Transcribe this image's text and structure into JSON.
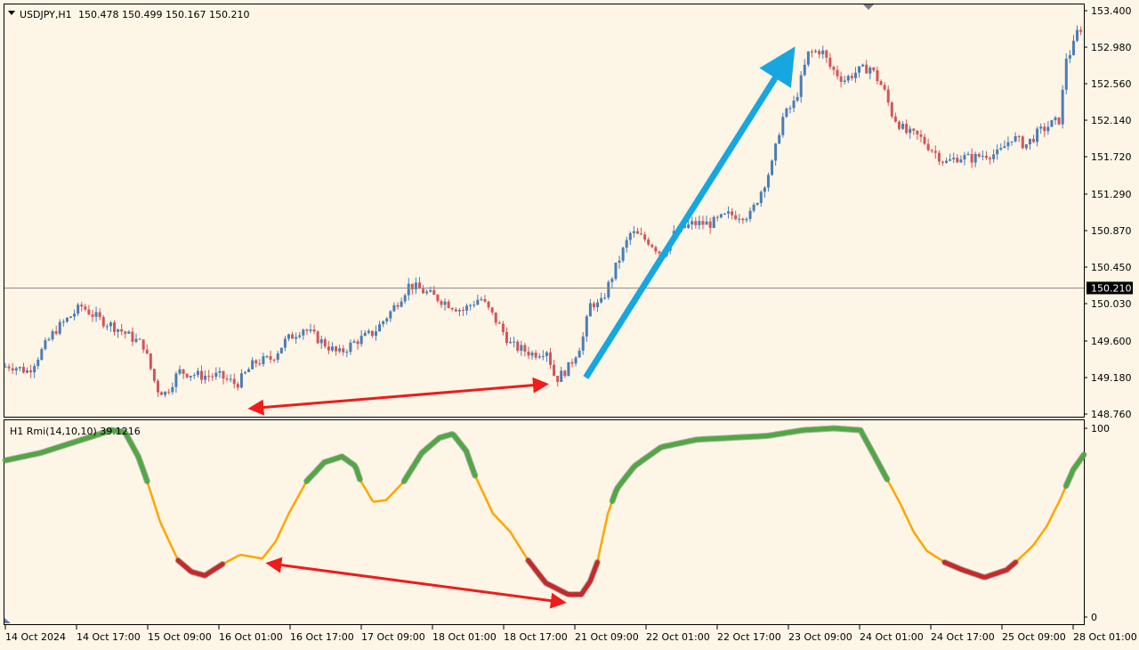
{
  "main": {
    "symbol_label": "USDJPY,H1",
    "ohlc_label": "150.478 150.499 150.167 150.210"
  },
  "indicator": {
    "label": "H1 Rmi(14,10,10) 39.1216"
  },
  "colors": {
    "background": "#FDF5E6",
    "bull_candle": "#4A7DB5",
    "bear_candle": "#D2555B",
    "price_line": "#8C8C8C",
    "current_price_box": "#000000",
    "rmi_neutral": "#FFA500",
    "rmi_bull": "#4FA843",
    "rmi_bear": "#C8282A",
    "trend_arrow": "#17A7E0",
    "divergence_arrow": "#EE1C1C",
    "grid_border": "#000000"
  },
  "chart_data": [
    {
      "type": "candlestick",
      "title": "USDJPY,H1",
      "ylim": [
        148.76,
        153.4
      ],
      "y_ticks": [
        "153.400",
        "152.980",
        "152.560",
        "152.140",
        "151.720",
        "151.290",
        "150.870",
        "150.450",
        "150.030",
        "149.600",
        "149.180",
        "148.760"
      ],
      "current_price": "150.210",
      "x_ticks": [
        "14 Oct 2024",
        "14 Oct 17:00",
        "15 Oct 09:00",
        "16 Oct 01:00",
        "16 Oct 17:00",
        "17 Oct 09:00",
        "18 Oct 01:00",
        "18 Oct 17:00",
        "21 Oct 09:00",
        "22 Oct 01:00",
        "22 Oct 17:00",
        "23 Oct 09:00",
        "24 Oct 01:00",
        "24 Oct 17:00",
        "25 Oct 09:00",
        "28 Oct 01:00"
      ],
      "close_path": [
        [
          0,
          149.3
        ],
        [
          10,
          149.32
        ],
        [
          30,
          149.25
        ],
        [
          60,
          149.72
        ],
        [
          90,
          150.0
        ],
        [
          110,
          149.85
        ],
        [
          130,
          149.75
        ],
        [
          160,
          149.55
        ],
        [
          175,
          149.05
        ],
        [
          185,
          149.0
        ],
        [
          200,
          149.25
        ],
        [
          225,
          149.2
        ],
        [
          245,
          149.2
        ],
        [
          265,
          149.1
        ],
        [
          285,
          149.35
        ],
        [
          305,
          149.4
        ],
        [
          320,
          149.6
        ],
        [
          340,
          149.75
        ],
        [
          360,
          149.6
        ],
        [
          380,
          149.45
        ],
        [
          400,
          149.6
        ],
        [
          420,
          149.7
        ],
        [
          440,
          149.95
        ],
        [
          460,
          150.25
        ],
        [
          480,
          150.15
        ],
        [
          500,
          150.05
        ],
        [
          520,
          149.95
        ],
        [
          540,
          150.1
        ],
        [
          560,
          149.8
        ],
        [
          575,
          149.55
        ],
        [
          600,
          149.45
        ],
        [
          615,
          149.5
        ],
        [
          625,
          149.15
        ],
        [
          640,
          149.3
        ],
        [
          655,
          149.6
        ],
        [
          665,
          150.05
        ],
        [
          675,
          150.0
        ],
        [
          695,
          150.5
        ],
        [
          710,
          150.85
        ],
        [
          730,
          150.75
        ],
        [
          745,
          150.6
        ],
        [
          760,
          150.85
        ],
        [
          780,
          150.95
        ],
        [
          800,
          150.95
        ],
        [
          820,
          151.05
        ],
        [
          845,
          151.05
        ],
        [
          860,
          151.4
        ],
        [
          870,
          151.65
        ],
        [
          880,
          152.15
        ],
        [
          895,
          152.35
        ],
        [
          910,
          152.9
        ],
        [
          925,
          152.95
        ],
        [
          935,
          152.75
        ],
        [
          950,
          152.6
        ],
        [
          965,
          152.7
        ],
        [
          980,
          152.75
        ],
        [
          995,
          152.5
        ],
        [
          1005,
          152.2
        ],
        [
          1020,
          152.0
        ],
        [
          1035,
          151.95
        ],
        [
          1050,
          151.8
        ],
        [
          1065,
          151.65
        ],
        [
          1080,
          151.72
        ],
        [
          1095,
          151.7
        ],
        [
          1110,
          151.75
        ],
        [
          1125,
          151.75
        ],
        [
          1140,
          151.95
        ],
        [
          1155,
          151.85
        ],
        [
          1170,
          152.0
        ],
        [
          1185,
          152.1
        ],
        [
          1195,
          152.15
        ],
        [
          1200,
          152.85
        ],
        [
          1208,
          152.95
        ],
        [
          1215,
          153.2
        ]
      ],
      "annotations": [
        {
          "type": "arrow",
          "color": "trend",
          "from": {
            "bar": 655,
            "price": 149.18
          },
          "to": {
            "bar": 890,
            "price": 152.95
          }
        },
        {
          "type": "double_arrow",
          "color": "divergence",
          "from": {
            "bar": 270,
            "price": 148.83
          },
          "to": {
            "bar": 620,
            "price": 149.1
          }
        }
      ]
    },
    {
      "type": "line",
      "title": "H1 Rmi(14,10,10) 39.1216",
      "ylim": [
        0,
        100
      ],
      "y_ticks": [
        "100",
        "0"
      ],
      "series": [
        {
          "values": [
            [
              0,
              83
            ],
            [
              40,
              87
            ],
            [
              80,
              93
            ],
            [
              120,
              99
            ],
            [
              135,
              98
            ],
            [
              150,
              85
            ],
            [
              160,
              72
            ],
            [
              175,
              50
            ],
            [
              195,
              30
            ],
            [
              210,
              24
            ],
            [
              225,
              22
            ],
            [
              245,
              28
            ],
            [
              265,
              33
            ],
            [
              290,
              31
            ],
            [
              305,
              40
            ],
            [
              320,
              55
            ],
            [
              340,
              72
            ],
            [
              360,
              82
            ],
            [
              380,
              85
            ],
            [
              395,
              80
            ],
            [
              400,
              73
            ],
            [
              415,
              61
            ],
            [
              430,
              62
            ],
            [
              450,
              72
            ],
            [
              470,
              87
            ],
            [
              490,
              95
            ],
            [
              505,
              97
            ],
            [
              520,
              88
            ],
            [
              530,
              75
            ],
            [
              550,
              55
            ],
            [
              570,
              45
            ],
            [
              590,
              30
            ],
            [
              610,
              18
            ],
            [
              635,
              12
            ],
            [
              650,
              12
            ],
            [
              660,
              19
            ],
            [
              668,
              29
            ],
            [
              680,
              55
            ],
            [
              690,
              68
            ],
            [
              710,
              80
            ],
            [
              740,
              90
            ],
            [
              780,
              94
            ],
            [
              820,
              95
            ],
            [
              860,
              96
            ],
            [
              900,
              99
            ],
            [
              935,
              100
            ],
            [
              965,
              99
            ],
            [
              980,
              86
            ],
            [
              995,
              73
            ],
            [
              1010,
              60
            ],
            [
              1025,
              45
            ],
            [
              1040,
              35
            ],
            [
              1060,
              29
            ],
            [
              1080,
              25
            ],
            [
              1105,
              21
            ],
            [
              1130,
              25
            ],
            [
              1140,
              29
            ],
            [
              1160,
              38
            ],
            [
              1175,
              48
            ],
            [
              1190,
              62
            ],
            [
              1205,
              78
            ],
            [
              1217,
              86
            ]
          ]
        }
      ],
      "state_segments": [
        {
          "from": 0,
          "to": 160,
          "state": "bull"
        },
        {
          "from": 195,
          "to": 245,
          "state": "bear"
        },
        {
          "from": 340,
          "to": 400,
          "state": "bull"
        },
        {
          "from": 450,
          "to": 530,
          "state": "bull"
        },
        {
          "from": 590,
          "to": 668,
          "state": "bear"
        },
        {
          "from": 685,
          "to": 995,
          "state": "bull"
        },
        {
          "from": 1060,
          "to": 1140,
          "state": "bear"
        },
        {
          "from": 1197,
          "to": 1217,
          "state": "bull"
        }
      ],
      "annotations": [
        {
          "type": "double_arrow",
          "color": "divergence",
          "from": {
            "bar": 290,
            "value": 28
          },
          "to": {
            "bar": 640,
            "value": 8
          }
        }
      ]
    }
  ]
}
